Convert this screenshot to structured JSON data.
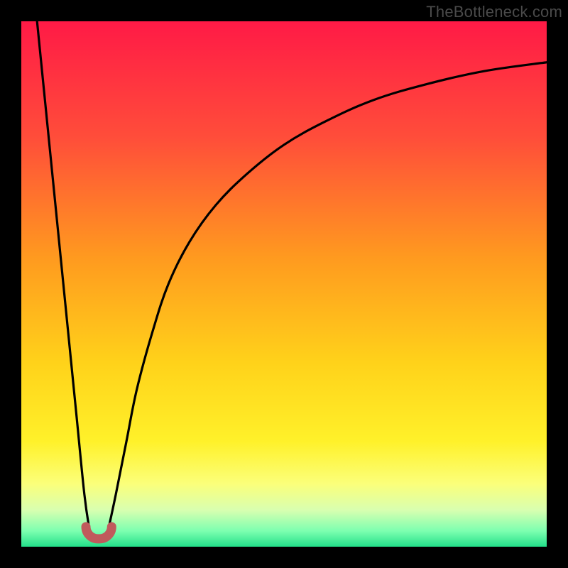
{
  "watermark": "TheBottleneck.com",
  "colors": {
    "frame": "#000000",
    "gradient_stops": [
      {
        "offset": 0.0,
        "color": "#ff1a46"
      },
      {
        "offset": 0.22,
        "color": "#ff4d3a"
      },
      {
        "offset": 0.45,
        "color": "#ff9a1f"
      },
      {
        "offset": 0.65,
        "color": "#ffd21a"
      },
      {
        "offset": 0.8,
        "color": "#fff12a"
      },
      {
        "offset": 0.88,
        "color": "#fbff7a"
      },
      {
        "offset": 0.93,
        "color": "#d9ffb0"
      },
      {
        "offset": 0.97,
        "color": "#7dffb0"
      },
      {
        "offset": 1.0,
        "color": "#23e08a"
      }
    ],
    "curve": "#000000",
    "marker_fill": "#c05a5c",
    "marker_stroke": "#a84a4c"
  },
  "chart_data": {
    "type": "line",
    "title": "",
    "xlabel": "",
    "ylabel": "",
    "xlim": [
      0,
      100
    ],
    "ylim": [
      0,
      100
    ],
    "series": [
      {
        "name": "left-branch",
        "x": [
          3.0,
          5.0,
          7.0,
          9.0,
          10.5,
          12.0,
          13.0
        ],
        "values": [
          100,
          80,
          60,
          40,
          25,
          10,
          3
        ]
      },
      {
        "name": "right-branch",
        "x": [
          16.5,
          18,
          20,
          22,
          25,
          28,
          32,
          37,
          43,
          50,
          58,
          67,
          77,
          88,
          100
        ],
        "values": [
          3,
          10,
          20,
          30,
          41,
          50,
          58,
          65,
          71,
          76.5,
          81,
          85,
          88,
          90.5,
          92.2
        ]
      }
    ],
    "marker": {
      "note": "U-shaped trough marker at curve minimum",
      "x_range": [
        12.3,
        17.2
      ],
      "y": 2.4
    }
  }
}
